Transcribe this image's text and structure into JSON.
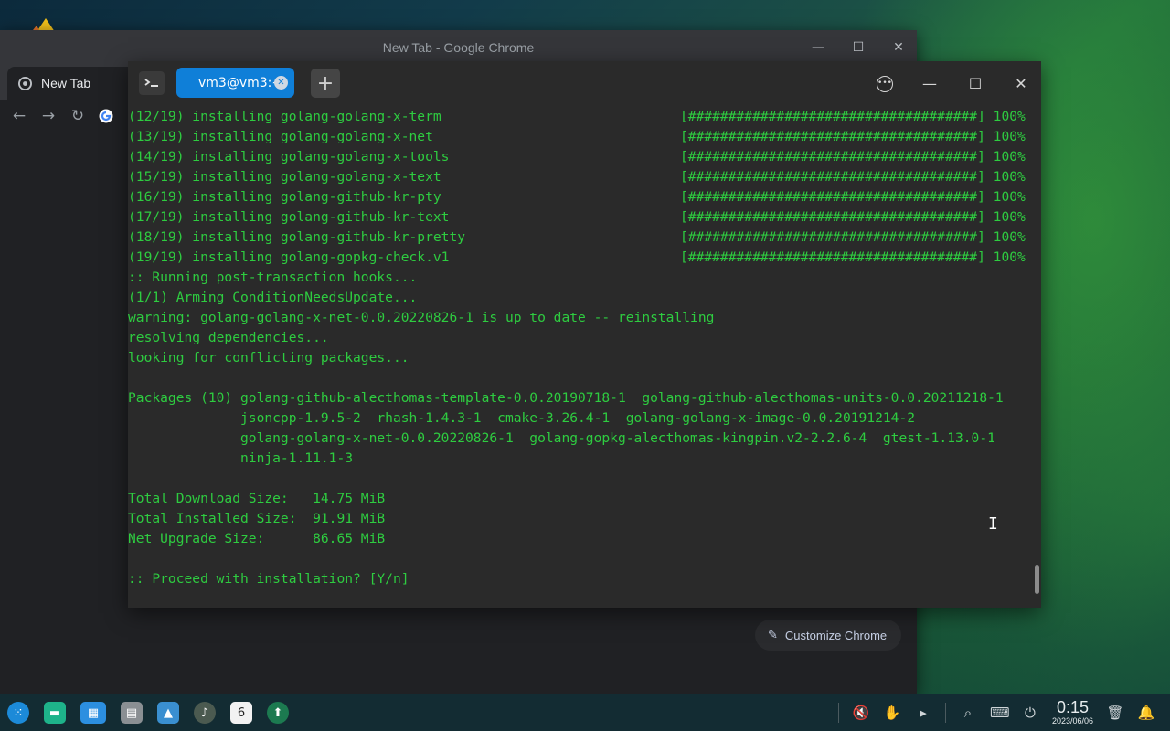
{
  "chrome": {
    "window_title": "New Tab - Google Chrome",
    "tab_label": "New Tab",
    "customize_label": "Customize Chrome"
  },
  "terminal": {
    "tab_label": "vm3@vm3:~",
    "lines": [
      {
        "text": "(12/19) installing golang-golang-x-term",
        "bar": "[####################################] 100%"
      },
      {
        "text": "(13/19) installing golang-golang-x-net",
        "bar": "[####################################] 100%"
      },
      {
        "text": "(14/19) installing golang-golang-x-tools",
        "bar": "[####################################] 100%"
      },
      {
        "text": "(15/19) installing golang-golang-x-text",
        "bar": "[####################################] 100%"
      },
      {
        "text": "(16/19) installing golang-github-kr-pty",
        "bar": "[####################################] 100%"
      },
      {
        "text": "(17/19) installing golang-github-kr-text",
        "bar": "[####################################] 100%"
      },
      {
        "text": "(18/19) installing golang-github-kr-pretty",
        "bar": "[####################################] 100%"
      },
      {
        "text": "(19/19) installing golang-gopkg-check.v1",
        "bar": "[####################################] 100%"
      },
      {
        "text": ":: Running post-transaction hooks...",
        "bar": ""
      },
      {
        "text": "(1/1) Arming ConditionNeedsUpdate...",
        "bar": ""
      },
      {
        "text": "warning: golang-golang-x-net-0.0.20220826-1 is up to date -- reinstalling",
        "bar": ""
      },
      {
        "text": "resolving dependencies...",
        "bar": ""
      },
      {
        "text": "looking for conflicting packages...",
        "bar": ""
      },
      {
        "text": "",
        "bar": ""
      },
      {
        "text": "Packages (10) golang-github-alecthomas-template-0.0.20190718-1  golang-github-alecthomas-units-0.0.20211218-1",
        "bar": ""
      },
      {
        "text": "              jsoncpp-1.9.5-2  rhash-1.4.3-1  cmake-3.26.4-1  golang-golang-x-image-0.0.20191214-2",
        "bar": ""
      },
      {
        "text": "              golang-golang-x-net-0.0.20220826-1  golang-gopkg-alecthomas-kingpin.v2-2.2.6-4  gtest-1.13.0-1",
        "bar": ""
      },
      {
        "text": "              ninja-1.11.1-3",
        "bar": ""
      },
      {
        "text": "",
        "bar": ""
      },
      {
        "text": "Total Download Size:   14.75 MiB",
        "bar": ""
      },
      {
        "text": "Total Installed Size:  91.91 MiB",
        "bar": ""
      },
      {
        "text": "Net Upgrade Size:      86.65 MiB",
        "bar": ""
      },
      {
        "text": "",
        "bar": ""
      },
      {
        "text": ":: Proceed with installation? [Y/n]",
        "bar": ""
      }
    ]
  },
  "taskbar": {
    "time": "0:15",
    "date": "2023/06/06",
    "calendar_day": "6"
  },
  "colors": {
    "terminal_text": "#2ecc40",
    "terminal_bg": "#2a2a2a",
    "tab_accent": "#0f7fd8",
    "taskbar_bg": "#132c33"
  }
}
